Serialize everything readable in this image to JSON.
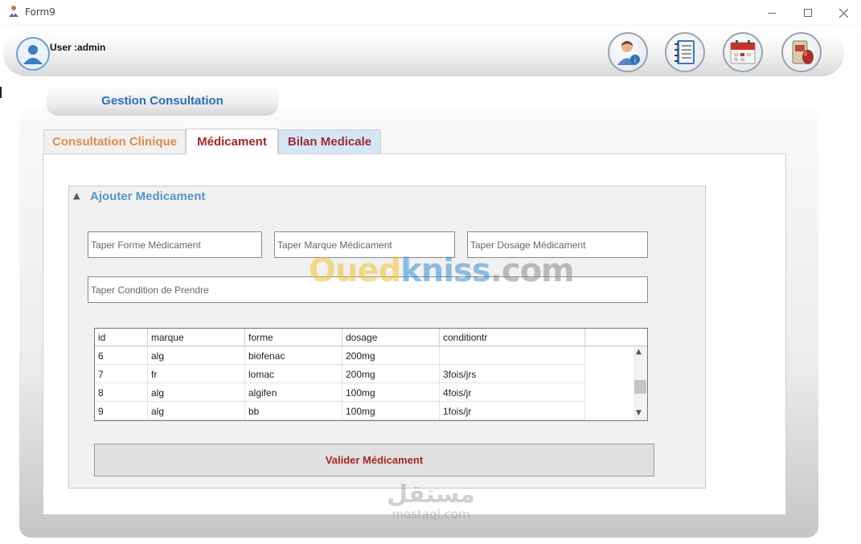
{
  "window": {
    "title": "Form9"
  },
  "header": {
    "user_label": "User :admin",
    "buttons": [
      "info-icon",
      "notebook-icon",
      "calendar-icon",
      "medicine-icon"
    ]
  },
  "section": {
    "title": "Gestion Consultation"
  },
  "tabs": [
    {
      "label": "Consultation Clinique"
    },
    {
      "label": "Médicament"
    },
    {
      "label": "Bilan Medicale"
    }
  ],
  "group": {
    "title": "Ajouter Medicament"
  },
  "fields": {
    "forme_placeholder": "Taper Forme Médicament",
    "marque_placeholder": "Taper Marque Médicament",
    "dosage_placeholder": "Taper Dosage Médicament",
    "condition_placeholder": "Taper Condition de Prendre"
  },
  "grid": {
    "columns": [
      "id",
      "marque",
      "forme",
      "dosage",
      "conditiontr"
    ],
    "rows": [
      [
        "6",
        "alg",
        "biofenac",
        "200mg",
        ""
      ],
      [
        "7",
        "fr",
        "lomac",
        "200mg",
        "3fois/jrs"
      ],
      [
        "8",
        "alg",
        "algifen",
        "100mg",
        "4fois/jr"
      ],
      [
        "9",
        "alg",
        "bb",
        "100mg",
        "1fois/jr"
      ]
    ]
  },
  "actions": {
    "validate_label": "Valider Médicament"
  },
  "watermarks": {
    "oued_part1": "Oued",
    "oued_part2": "kniss",
    "oued_part3": ".com",
    "mostaql_ar": "مستقل",
    "mostaql_en": "mostaql.com"
  },
  "colors": {
    "accent_blue": "#2b6cc4",
    "tab_orange": "#e08a4a",
    "tab_red": "#a42828",
    "group_title_blue": "#5b95d1"
  }
}
